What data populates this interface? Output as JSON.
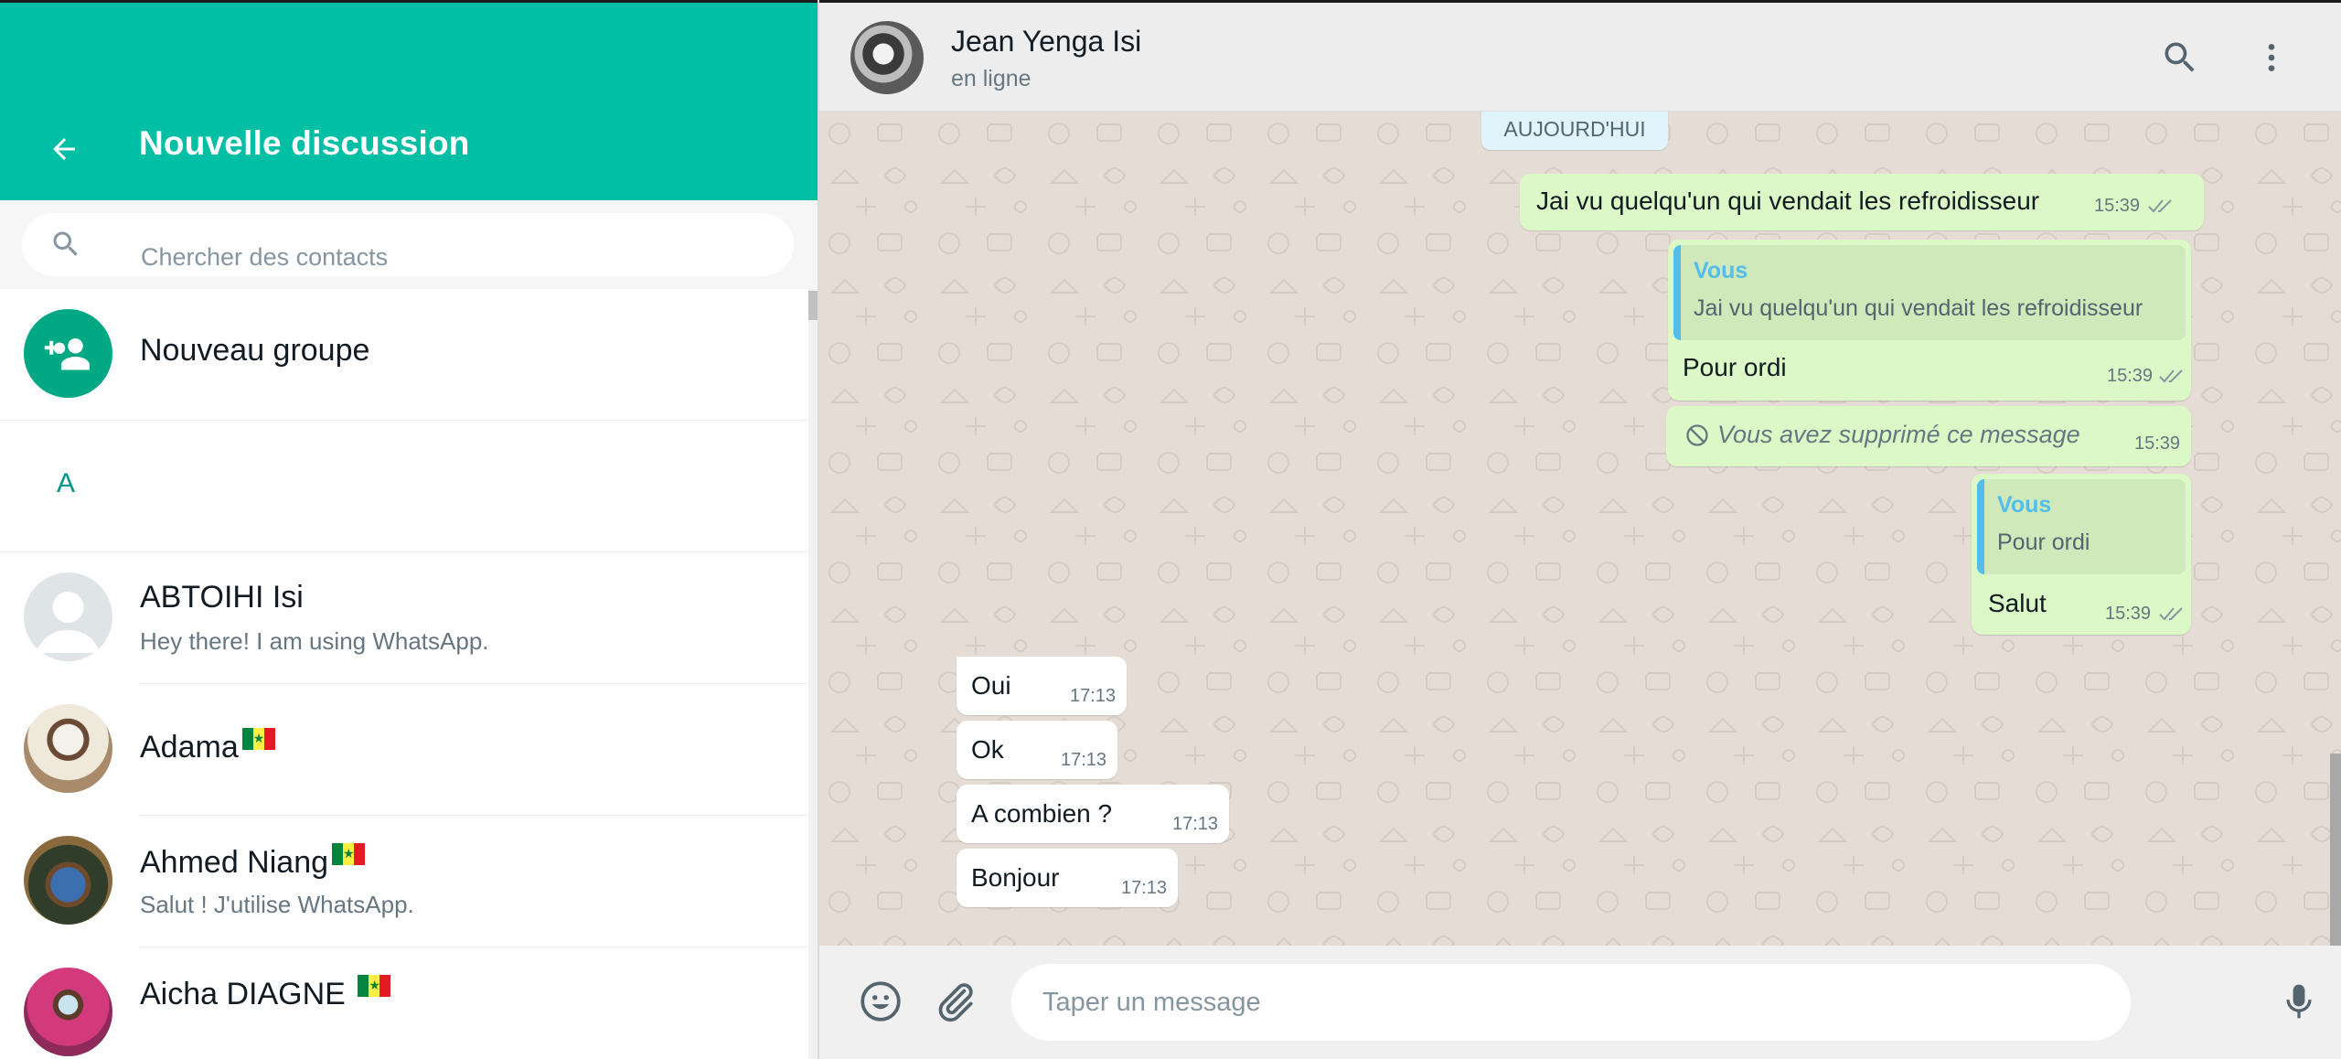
{
  "left_panel": {
    "title": "Nouvelle discussion",
    "search_placeholder": "Chercher des contacts",
    "new_group_label": "Nouveau groupe",
    "section_letter": "A",
    "contacts": [
      {
        "name": "ABTOIHI Isi",
        "status": "Hey there! I am using WhatsApp.",
        "flag": false
      },
      {
        "name": "Adama",
        "status": "",
        "flag": true
      },
      {
        "name": "Ahmed Niang",
        "status": "Salut ! J'utilise WhatsApp.",
        "flag": true
      },
      {
        "name": "Aicha DIAGNE ",
        "status": "",
        "flag": true
      }
    ]
  },
  "chat": {
    "contact_name": "Jean Yenga Isi",
    "contact_status": "en ligne",
    "date_chip": "AUJOURD'HUI",
    "messages": [
      {
        "direction": "out",
        "text": "Jai vu quelqu'un qui vendait les refroidisseur",
        "time": "15:39",
        "ticks": "double"
      },
      {
        "direction": "out",
        "quote_author": "Vous",
        "quote_text": "Jai vu quelqu'un qui vendait les refroidisseur",
        "text": "Pour ordi",
        "time": "15:39",
        "ticks": "double"
      },
      {
        "direction": "out",
        "deleted": true,
        "text": "Vous avez supprimé ce message",
        "time": "15:39"
      },
      {
        "direction": "out",
        "quote_author": "Vous",
        "quote_text": "Pour ordi",
        "text": "Salut",
        "time": "15:39",
        "ticks": "double"
      },
      {
        "direction": "in",
        "text": "Oui",
        "time": "17:13"
      },
      {
        "direction": "in",
        "text": "Ok",
        "time": "17:13"
      },
      {
        "direction": "in",
        "text": "A combien ?",
        "time": "17:13"
      },
      {
        "direction": "in",
        "text": "Bonjour",
        "time": "17:13"
      }
    ],
    "composer_placeholder": "Taper un message"
  },
  "icons": {
    "back": "arrow-left-icon",
    "search": "search-icon",
    "new_group": "group-add-icon",
    "menu": "more-vertical-icon",
    "emoji": "smiley-icon",
    "attach": "paperclip-icon",
    "mic": "microphone-icon",
    "read": "double-check-icon",
    "deleted": "prohibited-icon"
  },
  "colors": {
    "header_teal": "#00bfa5",
    "accent_teal": "#009688",
    "outgoing_bubble": "#dcf8c6",
    "incoming_bubble": "#ffffff",
    "chat_background": "#e5ddd5",
    "quote_author": "#53bdeb",
    "read_ticks": "#8696a0"
  }
}
